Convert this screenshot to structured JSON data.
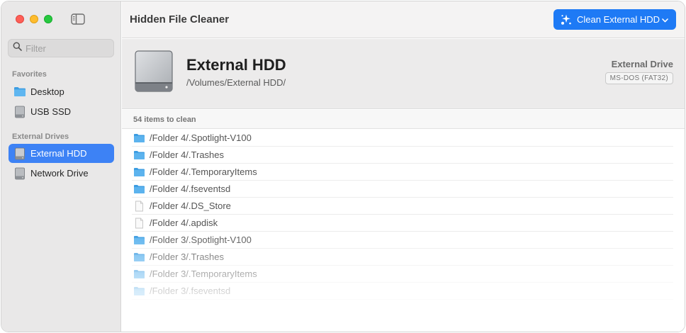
{
  "sidebar": {
    "filter_placeholder": "Filter",
    "sections": [
      {
        "label": "Favorites",
        "items": [
          {
            "label": "Desktop",
            "icon": "folder-icon",
            "selected": false
          },
          {
            "label": "USB SSD",
            "icon": "drive-icon",
            "selected": false
          }
        ]
      },
      {
        "label": "External Drives",
        "items": [
          {
            "label": "External HDD",
            "icon": "drive-icon",
            "selected": true
          },
          {
            "label": "Network Drive",
            "icon": "drive-icon",
            "selected": false
          }
        ]
      }
    ]
  },
  "toolbar": {
    "title": "Hidden File Cleaner",
    "clean_button_label": "Clean External HDD"
  },
  "drive": {
    "name": "External HDD",
    "path": "/Volumes/External HDD/",
    "type": "External Drive",
    "filesystem": "MS-DOS (FAT32)"
  },
  "items": {
    "count_label": "54 items to clean",
    "rows": [
      {
        "path": "/Folder 4/.Spotlight-V100",
        "kind": "folder"
      },
      {
        "path": "/Folder 4/.Trashes",
        "kind": "folder"
      },
      {
        "path": "/Folder 4/.TemporaryItems",
        "kind": "folder"
      },
      {
        "path": "/Folder 4/.fseventsd",
        "kind": "folder"
      },
      {
        "path": "/Folder 4/.DS_Store",
        "kind": "file"
      },
      {
        "path": "/Folder 4/.apdisk",
        "kind": "file"
      },
      {
        "path": "/Folder 3/.Spotlight-V100",
        "kind": "folder"
      },
      {
        "path": "/Folder 3/.Trashes",
        "kind": "folder"
      },
      {
        "path": "/Folder 3/.TemporaryItems",
        "kind": "folder"
      },
      {
        "path": "/Folder 3/.fseventsd",
        "kind": "folder"
      }
    ]
  },
  "colors": {
    "accent": "#1e7af5",
    "selection": "#3d82f5",
    "folder": "#4aa8e8"
  }
}
